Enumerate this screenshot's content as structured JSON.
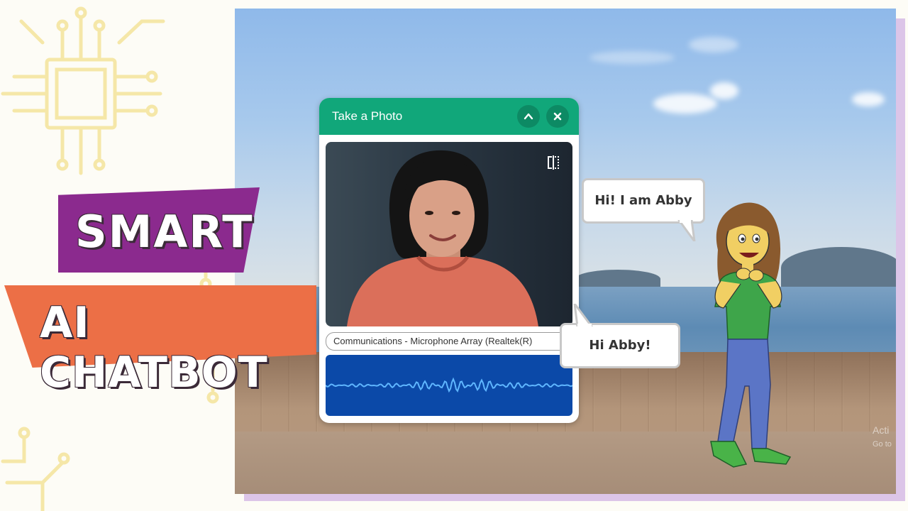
{
  "title": {
    "line1": "SMART",
    "line2": "AI CHATBOT"
  },
  "photo_window": {
    "title": "Take a Photo",
    "collapse_icon": "chevron-up-icon",
    "close_icon": "close-icon",
    "flip_icon": "flip-camera-icon",
    "microphone": "Communications - Microphone Array (Realtek(R)"
  },
  "chat": {
    "abby_message": "Hi! I am Abby",
    "user_message": "Hi Abby!"
  },
  "watermark": {
    "line1": "Acti",
    "line2": "Go to"
  },
  "colors": {
    "window_header": "#11a77a",
    "waveform_bg": "#0b49a8",
    "banner_purple": "#8b2a8e",
    "banner_orange": "#ec6f46"
  }
}
